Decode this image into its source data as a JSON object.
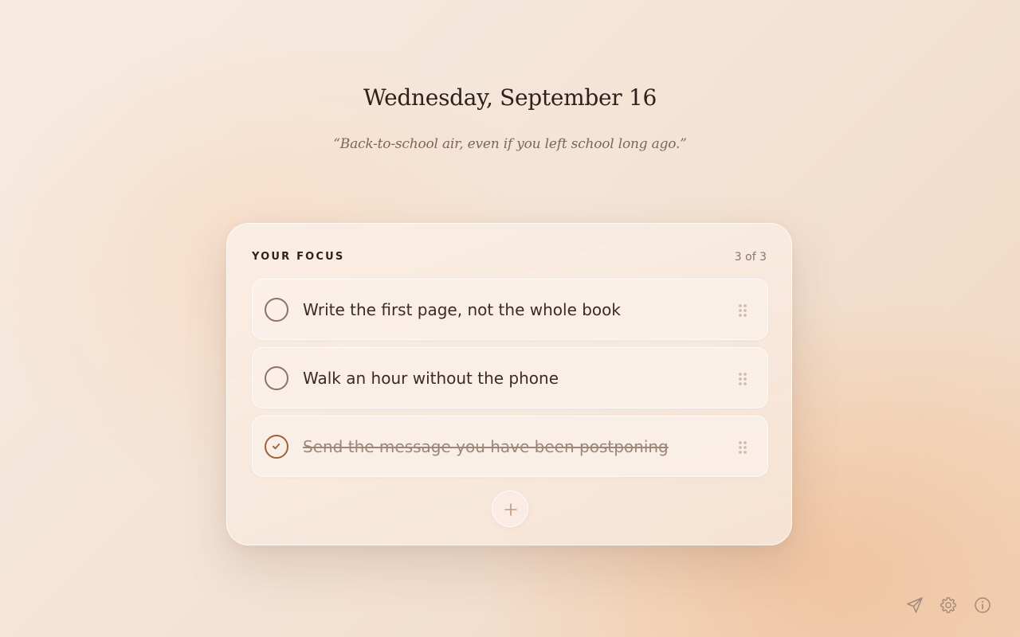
{
  "header": {
    "date": "Wednesday, September 16",
    "quote": "“Back-to-school air, even if you left school long ago.”"
  },
  "focus_card": {
    "title": "YOUR FOCUS",
    "count": "3 of 3",
    "tasks": [
      {
        "text": "Write the first page, not the whole book",
        "completed": false
      },
      {
        "text": "Walk an hour without the phone",
        "completed": false
      },
      {
        "text": "Send the message you have been postponing",
        "completed": true
      }
    ],
    "add_icon": "plus-icon"
  },
  "footer": {
    "icons": [
      "send-icon",
      "gear-icon",
      "info-icon"
    ]
  },
  "colors": {
    "text_dark": "#2f2119",
    "text_muted": "#8a7568",
    "accent_checked": "#a0603c",
    "checkbox_border": "#8b7466"
  }
}
